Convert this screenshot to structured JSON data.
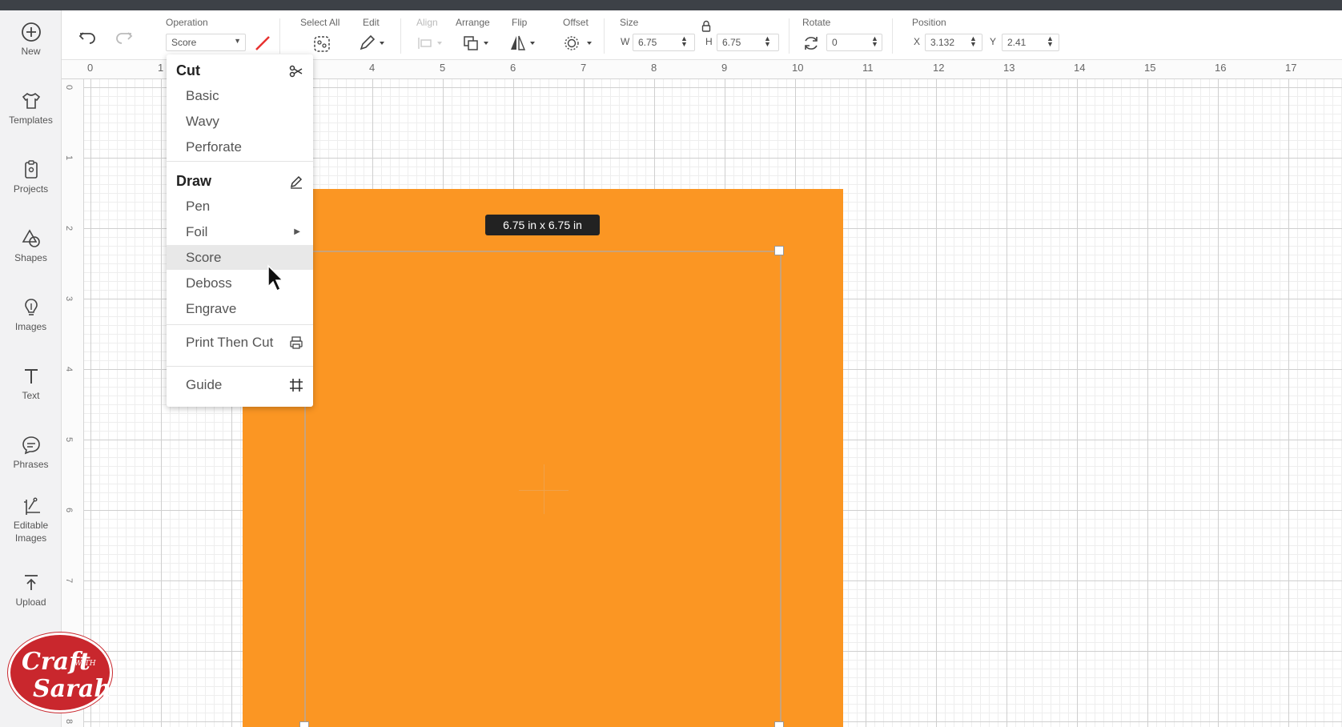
{
  "sidebar": {
    "items": [
      {
        "label": "New"
      },
      {
        "label": "Templates"
      },
      {
        "label": "Projects"
      },
      {
        "label": "Shapes"
      },
      {
        "label": "Images"
      },
      {
        "label": "Text"
      },
      {
        "label": "Phrases"
      },
      {
        "label": "Editable Images"
      },
      {
        "label": "Upload"
      }
    ]
  },
  "toolbar": {
    "operation_label": "Operation",
    "operation_value": "Score",
    "select_all_label": "Select All",
    "edit_label": "Edit",
    "align_label": "Align",
    "arrange_label": "Arrange",
    "flip_label": "Flip",
    "offset_label": "Offset",
    "size_label": "Size",
    "size_w_label": "W",
    "size_w_value": "6.75",
    "size_h_label": "H",
    "size_h_value": "6.75",
    "rotate_label": "Rotate",
    "rotate_value": "0",
    "position_label": "Position",
    "pos_x_label": "X",
    "pos_x_value": "3.132",
    "pos_y_label": "Y",
    "pos_y_value": "2.41"
  },
  "ruler": {
    "top": [
      "0",
      "1",
      "4",
      "5",
      "6",
      "7",
      "8",
      "9",
      "10",
      "11",
      "12",
      "13",
      "14",
      "15",
      "16",
      "17"
    ],
    "left": [
      "0",
      "1",
      "2",
      "3",
      "4",
      "5",
      "6",
      "7",
      "8"
    ]
  },
  "canvas": {
    "size_tooltip": "6.75  in x 6.75  in",
    "shape_color": "#fb9623"
  },
  "menu": {
    "cut_heading": "Cut",
    "cut_items": [
      "Basic",
      "Wavy",
      "Perforate"
    ],
    "draw_heading": "Draw",
    "draw_items": [
      "Pen",
      "Foil",
      "Score",
      "Deboss",
      "Engrave"
    ],
    "print_then_cut": "Print Then Cut",
    "guide": "Guide"
  },
  "logo": {
    "line1": "Craft",
    "line2": "WITH",
    "line3": "Sarah"
  }
}
